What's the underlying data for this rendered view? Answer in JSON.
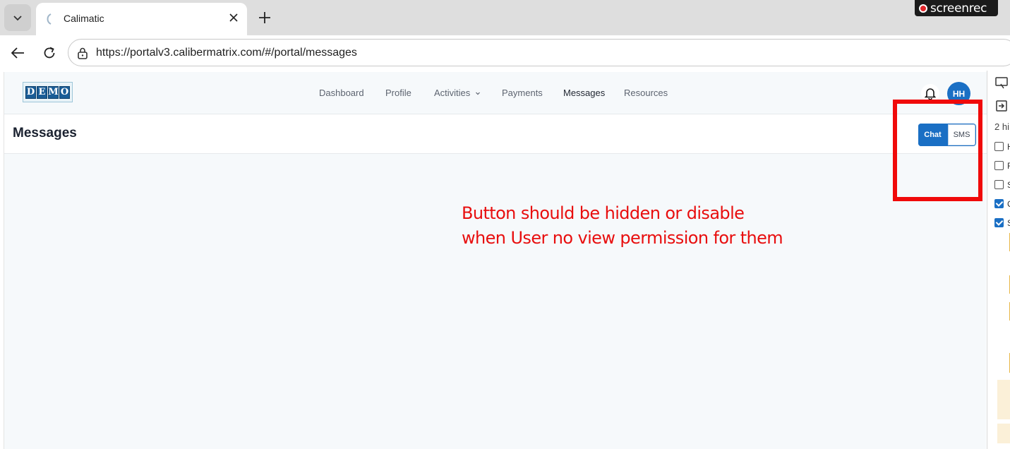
{
  "browser": {
    "tab_title": "Calimatic",
    "url": "https://portalv3.calibermatrix.com/#/portal/messages",
    "recorder_label": "screenrec"
  },
  "app": {
    "logo_letters": [
      "D",
      "E",
      "M",
      "O"
    ],
    "nav": [
      {
        "label": "Dashboard",
        "active": false
      },
      {
        "label": "Profile",
        "active": false
      },
      {
        "label": "Activities",
        "active": false,
        "has_dropdown": true
      },
      {
        "label": "Payments",
        "active": false
      },
      {
        "label": "Messages",
        "active": true
      },
      {
        "label": "Resources",
        "active": false
      }
    ],
    "avatar_initials": "HH",
    "page_title": "Messages",
    "toggle": {
      "chat_label": "Chat",
      "sms_label": "SMS",
      "selected": "Chat"
    }
  },
  "annotation": {
    "line1": "Button should be hidden or disable",
    "line2": "when User no view permission for them",
    "color": "#f00a0a"
  },
  "side_panel": {
    "count_text": "2 hi",
    "checkboxes": [
      {
        "label": "H",
        "checked": false
      },
      {
        "label": "F",
        "checked": false
      },
      {
        "label": "S",
        "checked": false
      },
      {
        "label": "C",
        "checked": true
      },
      {
        "label": "S",
        "checked": true
      }
    ]
  },
  "colors": {
    "accent": "#1a6fc4",
    "page_bg": "#f6f9fb",
    "annotation_red": "#f00a0a"
  }
}
